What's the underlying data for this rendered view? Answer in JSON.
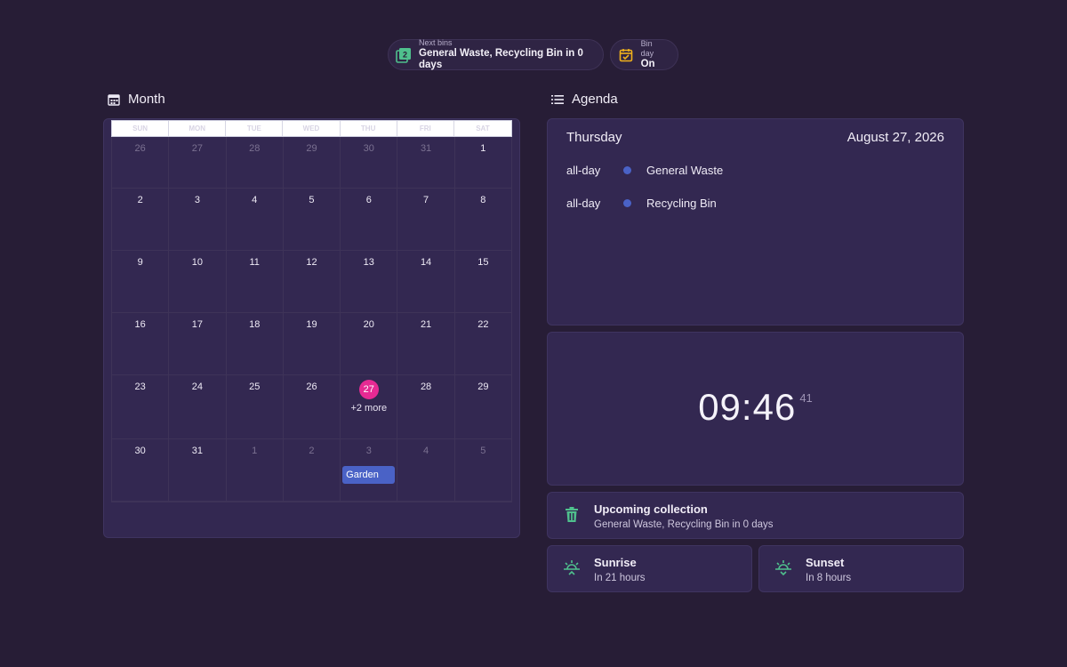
{
  "chips": {
    "next_bins": {
      "title": "Next bins",
      "value": "General Waste, Recycling Bin in 0 days",
      "icon": "bins-count-icon"
    },
    "bin_day": {
      "title": "Bin day",
      "value": "On",
      "icon": "calendar-check-icon"
    }
  },
  "month": {
    "title": "Month",
    "weekdays": [
      "SUN",
      "MON",
      "TUE",
      "WED",
      "THU",
      "FRI",
      "SAT"
    ],
    "weeks": [
      [
        "26",
        "27",
        "28",
        "29",
        "30",
        "31",
        "1"
      ],
      [
        "2",
        "3",
        "4",
        "5",
        "6",
        "7",
        "8"
      ],
      [
        "9",
        "10",
        "11",
        "12",
        "13",
        "14",
        "15"
      ],
      [
        "16",
        "17",
        "18",
        "19",
        "20",
        "21",
        "22"
      ],
      [
        "23",
        "24",
        "25",
        "26",
        "27",
        "28",
        "29"
      ],
      [
        "30",
        "31",
        "1",
        "2",
        "3",
        "4",
        "5"
      ]
    ],
    "today_more": "+2 more",
    "event_garden": "Garden"
  },
  "agenda": {
    "title": "Agenda",
    "day": "Thursday",
    "date": "August 27, 2026",
    "events": [
      {
        "when": "all-day",
        "name": "General Waste"
      },
      {
        "when": "all-day",
        "name": "Recycling Bin"
      }
    ]
  },
  "clock": {
    "hm": "09:46",
    "sec": "41"
  },
  "upcoming": {
    "title": "Upcoming collection",
    "value": "General Waste, Recycling Bin in 0 days"
  },
  "sunrise": {
    "title": "Sunrise",
    "value": "In 21 hours"
  },
  "sunset": {
    "title": "Sunset",
    "value": "In 8 hours"
  },
  "colors": {
    "background": "#271d36",
    "card": "#332851",
    "today": "#e62a93",
    "event": "#4a62c6",
    "accent_green": "#4fc08d",
    "accent_yellow": "#f1b21b"
  }
}
